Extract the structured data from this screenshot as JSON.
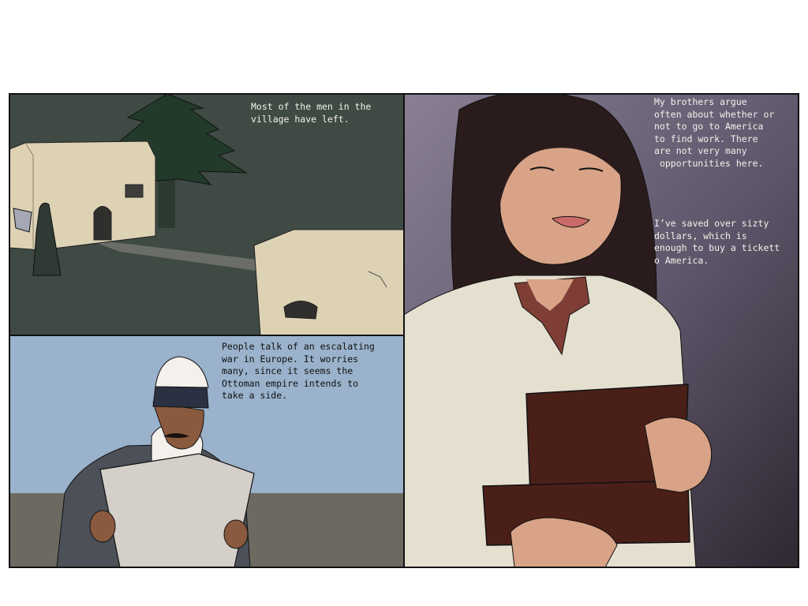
{
  "comic": {
    "panels": [
      {
        "caption": "Most of the men in the\nvillage have left."
      },
      {
        "caption": "People talk of an escalating\nwar in Europe. It worries\nmany, since it seems the\nOttoman empire intends to\ntake a side."
      },
      {
        "caption_1": "My brothers argue\noften about whether or\nnot to go to America\nto find work. There\nare not very many\n opportunities here.",
        "caption_2": "I’ve saved over sizty\ndollars, which is\nenough to buy a tickett\no America."
      }
    ]
  },
  "colors": {
    "night_ground": "#3f4a44",
    "day_sky": "#9ab2cb",
    "wall": "#6c6a60",
    "portrait_bg_top": "#8a7f93",
    "portrait_bg_bottom": "#2e2832",
    "stone": "#ddd2b4",
    "skin": "#d8a386",
    "hair": "#2a1c1c",
    "book": "#4a1f18"
  }
}
